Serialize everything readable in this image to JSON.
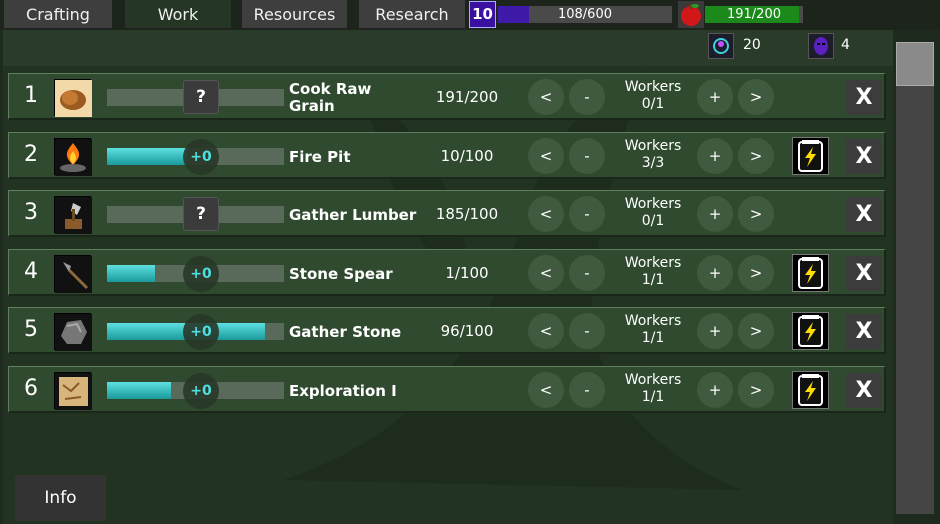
{
  "tabs": [
    {
      "label": "Crafting"
    },
    {
      "label": "Work"
    },
    {
      "label": "Resources"
    },
    {
      "label": "Research"
    }
  ],
  "level": "10",
  "xp": {
    "text": "108/600",
    "fraction": 0.18
  },
  "food": {
    "text": "191/200",
    "fraction": 0.955
  },
  "stats": {
    "population": "20",
    "villains": "4"
  },
  "jobs": [
    {
      "num": "1",
      "icon": "bread-icon",
      "name": "Cook Raw Grain",
      "count": "191/200",
      "workers": "Workers",
      "workers_val": "0/1",
      "progress": null,
      "boost": false
    },
    {
      "num": "2",
      "icon": "fire-pit-icon",
      "name": "Fire Pit",
      "count": "10/100",
      "workers": "Workers",
      "workers_val": "3/3",
      "progress": 0.45,
      "boost": true
    },
    {
      "num": "3",
      "icon": "axe-stump-icon",
      "name": "Gather Lumber",
      "count": "185/100",
      "workers": "Workers",
      "workers_val": "0/1",
      "progress": null,
      "boost": false
    },
    {
      "num": "4",
      "icon": "spear-icon",
      "name": "Stone Spear",
      "count": "1/100",
      "workers": "Workers",
      "workers_val": "1/1",
      "progress": 0.27,
      "boost": true
    },
    {
      "num": "5",
      "icon": "stone-icon",
      "name": "Gather Stone",
      "count": "96/100",
      "workers": "Workers",
      "workers_val": "1/1",
      "progress": 0.89,
      "boost": true
    },
    {
      "num": "6",
      "icon": "map-scroll-icon",
      "name": "Exploration I",
      "count": "",
      "workers": "Workers",
      "workers_val": "1/1",
      "progress": 0.36,
      "boost": true
    }
  ],
  "progress_unknown": "?",
  "progress_plus": "+0",
  "buttons": {
    "prev": "<",
    "minus": "-",
    "plus": "+",
    "next": ">",
    "remove": "X"
  },
  "info_label": "Info",
  "colors": {
    "accent_cyan": "#2ec4c4",
    "xp_purple": "#3f1aa8",
    "food_green": "#1b8a1b"
  }
}
